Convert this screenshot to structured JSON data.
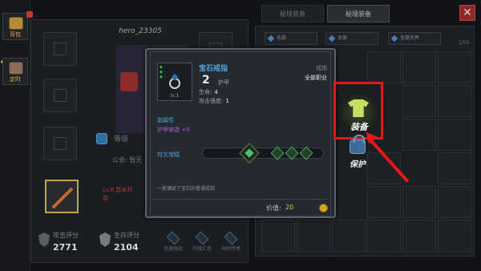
{
  "sidebar": {
    "items": [
      {
        "label": "背包"
      },
      {
        "label": "定时"
      }
    ]
  },
  "character": {
    "hero_name": "hero_23305",
    "mid_text": "等级",
    "guild_text": "公会: 暂无",
    "red_item_text": "Lv.6 暂未开启",
    "stats": [
      {
        "label": "攻击评分",
        "value": "2771"
      },
      {
        "label": "生存评分",
        "value": "2104"
      }
    ],
    "actions": [
      "全身强化",
      "升级汇总",
      "共同传承"
    ]
  },
  "tabs": [
    {
      "label": "秘境装备"
    },
    {
      "label": "秘境装备"
    }
  ],
  "close_label": "✕",
  "filters": [
    {
      "label": "全部"
    },
    {
      "label": "全部"
    },
    {
      "label": "全部大件"
    }
  ],
  "inventory_count": "1/50",
  "tooltip": {
    "item_name": "宝石戒指",
    "enhance_level": "2",
    "item_type": "护甲",
    "level_label": "lv.1",
    "attributes": [
      {
        "label": "生命:",
        "value": "4"
      },
      {
        "label": "攻击强度:",
        "value": "1"
      }
    ],
    "right_label": "戒指",
    "class_label": "全部职业",
    "secondary_title": "副属性",
    "secondary_value": "护甲穿透 +5",
    "socket_label": "符文增幅",
    "description": "一枚镶嵌了宝石的普通戒指",
    "price_label": "价值:",
    "price_value": "20"
  },
  "buttons": {
    "equip": "装备",
    "protect": "保护"
  },
  "colors": {
    "highlight": "#e5171b",
    "accent_blue": "#4fa3e0",
    "accent_purple": "#b25ce0",
    "gold": "#e2c24b"
  }
}
